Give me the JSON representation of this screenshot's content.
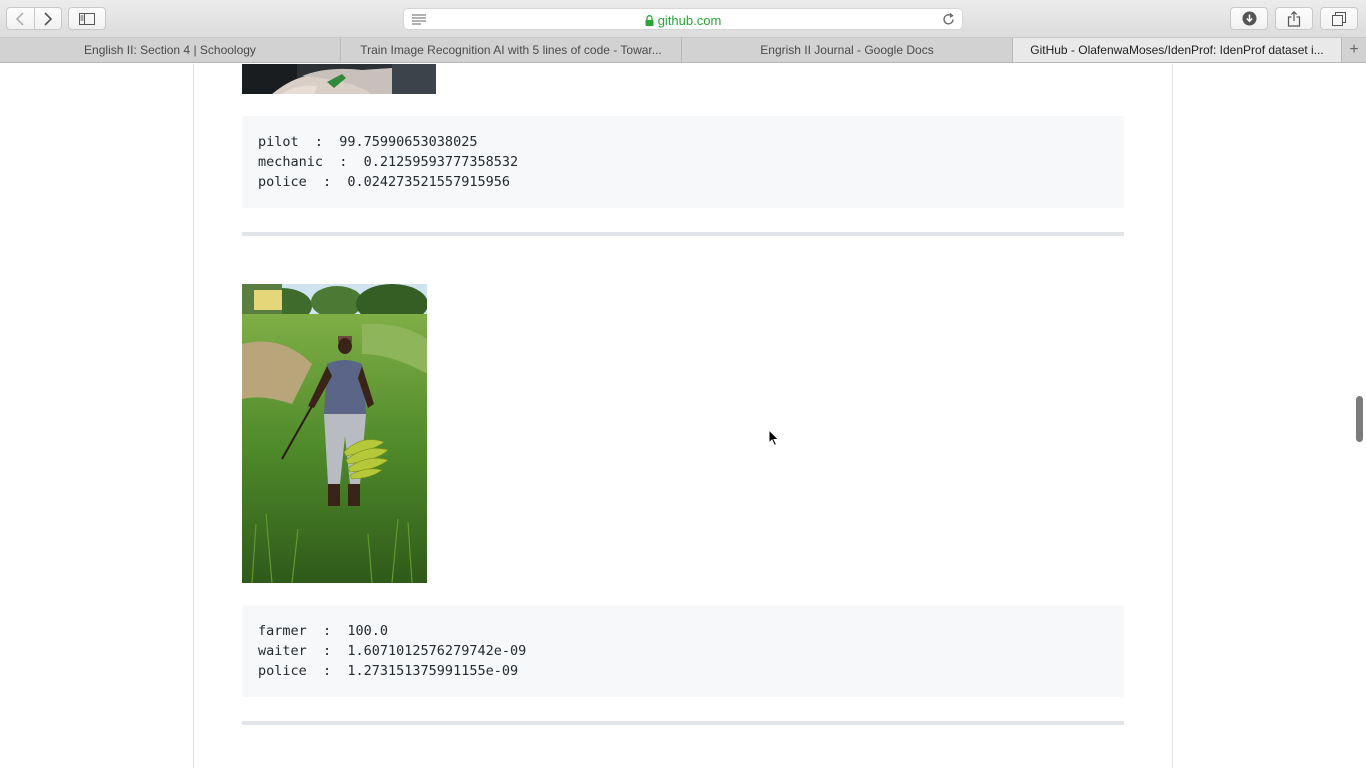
{
  "toolbar": {
    "url": "github.com",
    "icons": [
      "back-icon",
      "forward-icon",
      "sidebar-icon",
      "reader-icon",
      "lock-icon",
      "reload-icon",
      "download-icon",
      "share-icon",
      "tabs-icon"
    ]
  },
  "tabs": [
    {
      "label": "English II: Section 4 | Schoology"
    },
    {
      "label": "Train Image Recognition AI with 5 lines of code - Towar..."
    },
    {
      "label": "Engrish II Journal - Google Docs"
    },
    {
      "label": "GitHub - OlafenwaMoses/IdenProf: IdenProf dataset i..."
    }
  ],
  "new_tab_label": "+",
  "results": [
    {
      "lines": [
        "pilot  :  99.75990653038025",
        "mechanic  :  0.21259593777358532",
        "police  :  0.024273521557915956"
      ]
    },
    {
      "lines": [
        "farmer  :  100.0",
        "waiter  :  1.6071012576279742e-09",
        "police  :  1.273151375991155e-09"
      ]
    }
  ],
  "colors": {
    "url_green": "#27a836",
    "code_bg": "#f6f8fa",
    "divider": "#e1e4e8"
  }
}
